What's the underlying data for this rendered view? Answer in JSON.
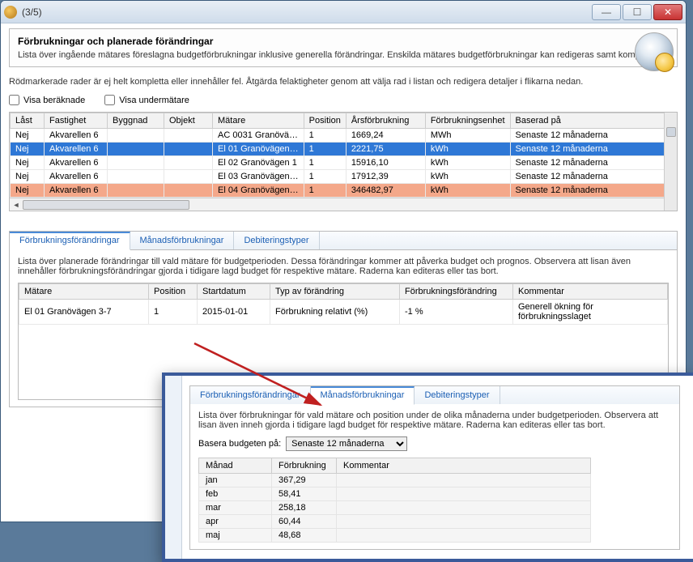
{
  "window": {
    "title": "(3/5)"
  },
  "header": {
    "title": "Förbrukningar och planerade förändringar",
    "desc": "Lista över ingående mätares föreslagna budgetförbrukningar inklusive generella förändringar. Enskilda mätares budgetförbrukningar kan redigeras samt komplette"
  },
  "info": "Rödmarkerade rader är ej helt kompletta eller innehåller fel. Åtgärda felaktigheter genom att välja rad i listan och redigera detaljer i flikarna nedan.",
  "checks": {
    "visa_beraknade": "Visa beräknade",
    "visa_undermatare": "Visa undermätare"
  },
  "grid1": {
    "headers": {
      "last": "Låst",
      "fastighet": "Fastighet",
      "byggnad": "Byggnad",
      "objekt": "Objekt",
      "matare": "Mätare",
      "position": "Position",
      "arsforbrukning": "Årsförbrukning",
      "forbrukningsenhet": "Förbrukningsenhet",
      "baserad": "Baserad på"
    },
    "rows": [
      {
        "last": "Nej",
        "fastighet": "Akvarellen 6",
        "byggnad": "",
        "objekt": "",
        "matare": "AC 0031 Granövä…",
        "position": "1",
        "ars": "1669,24",
        "enhet": "MWh",
        "bas": "Senaste 12 månaderna",
        "cls": ""
      },
      {
        "last": "Nej",
        "fastighet": "Akvarellen 6",
        "byggnad": "",
        "objekt": "",
        "matare": "El 01 Granövägen…",
        "position": "1",
        "ars": "2221,75",
        "enhet": "kWh",
        "bas": "Senaste 12 månaderna",
        "cls": "row-sel"
      },
      {
        "last": "Nej",
        "fastighet": "Akvarellen 6",
        "byggnad": "",
        "objekt": "",
        "matare": "El 02 Granövägen 1",
        "position": "1",
        "ars": "15916,10",
        "enhet": "kWh",
        "bas": "Senaste 12 månaderna",
        "cls": ""
      },
      {
        "last": "Nej",
        "fastighet": "Akvarellen 6",
        "byggnad": "",
        "objekt": "",
        "matare": "El 03 Granövägen…",
        "position": "1",
        "ars": "17912,39",
        "enhet": "kWh",
        "bas": "Senaste 12 månaderna",
        "cls": ""
      },
      {
        "last": "Nej",
        "fastighet": "Akvarellen 6",
        "byggnad": "",
        "objekt": "",
        "matare": "El 04 Granövägen…",
        "position": "1",
        "ars": "346482,97",
        "enhet": "kWh",
        "bas": "Senaste 12 månaderna",
        "cls": "row-err"
      }
    ]
  },
  "tabs1": {
    "t1": "Förbrukningsförändringar",
    "t2": "Månadsförbrukningar",
    "t3": "Debiteringstyper",
    "desc": "Lista över planerade förändringar till vald mätare för budgetperioden. Dessa förändringar kommer att påverka budget och prognos. Observera att lisan även innehåller förbrukningsförändringar gjorda i tidigare lagd budget för respektive mätare. Raderna kan editeras eller tas bort."
  },
  "grid2": {
    "headers": {
      "matare": "Mätare",
      "position": "Position",
      "start": "Startdatum",
      "typ": "Typ av förändring",
      "forandring": "Förbrukningsförändring",
      "kommentar": "Kommentar"
    },
    "row": {
      "matare": "El 01 Granövägen 3-7",
      "position": "1",
      "start": "2015-01-01",
      "typ": "Förbrukning relativt (%)",
      "forandring": "-1 %",
      "kommentar": "Generell ökning för förbrukningsslaget"
    }
  },
  "overlay": {
    "tabs": {
      "t1": "Förbrukningsförändringar",
      "t2": "Månadsförbrukningar",
      "t3": "Debiteringstyper"
    },
    "desc": "Lista över förbrukningar för vald mätare och position under de olika månaderna under budgetperioden. Observera att lisan även inneh gjorda i tidigare lagd budget för respektive mätare. Raderna kan editeras eller tas bort.",
    "basis_label": "Basera budgeten på:",
    "basis_value": "Senaste 12 månaderna",
    "grid_headers": {
      "manad": "Månad",
      "forbrukning": "Förbrukning",
      "kommentar": "Kommentar"
    },
    "rows": [
      {
        "m": "jan",
        "v": "367,29"
      },
      {
        "m": "feb",
        "v": "58,41"
      },
      {
        "m": "mar",
        "v": "258,18"
      },
      {
        "m": "apr",
        "v": "60,44"
      },
      {
        "m": "maj",
        "v": "48,68"
      }
    ]
  }
}
